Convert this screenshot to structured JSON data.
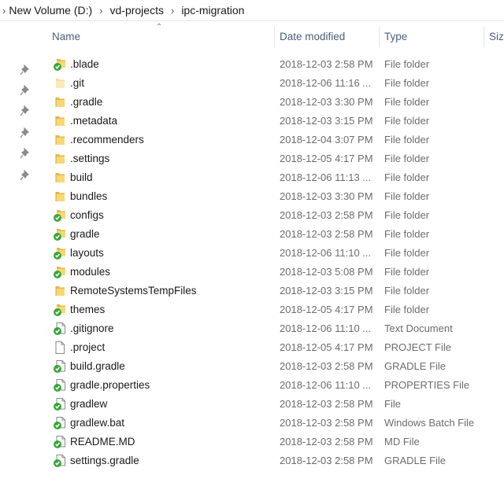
{
  "breadcrumb": [
    "New Volume (D:)",
    "vd-projects",
    "ipc-migration"
  ],
  "columns": {
    "name": "Name",
    "date": "Date modified",
    "type": "Type",
    "size": "Size"
  },
  "rows": [
    {
      "name": ".blade",
      "date": "2018-12-03 2:58 PM",
      "type": "File folder",
      "icon": "folder-sync-icon"
    },
    {
      "name": ".git",
      "date": "2018-12-06 11:16 ...",
      "type": "File folder",
      "icon": "folder-hidden-icon"
    },
    {
      "name": ".gradle",
      "date": "2018-12-03 3:30 PM",
      "type": "File folder",
      "icon": "folder-icon"
    },
    {
      "name": ".metadata",
      "date": "2018-12-03 3:15 PM",
      "type": "File folder",
      "icon": "folder-icon"
    },
    {
      "name": ".recommenders",
      "date": "2018-12-04 3:07 PM",
      "type": "File folder",
      "icon": "folder-icon"
    },
    {
      "name": ".settings",
      "date": "2018-12-05 4:17 PM",
      "type": "File folder",
      "icon": "folder-icon"
    },
    {
      "name": "build",
      "date": "2018-12-06 11:13 ...",
      "type": "File folder",
      "icon": "folder-icon"
    },
    {
      "name": "bundles",
      "date": "2018-12-03 3:30 PM",
      "type": "File folder",
      "icon": "folder-icon"
    },
    {
      "name": "configs",
      "date": "2018-12-03 2:58 PM",
      "type": "File folder",
      "icon": "folder-sync-icon"
    },
    {
      "name": "gradle",
      "date": "2018-12-03 2:58 PM",
      "type": "File folder",
      "icon": "folder-sync-icon"
    },
    {
      "name": "layouts",
      "date": "2018-12-06 11:10 ...",
      "type": "File folder",
      "icon": "folder-sync-icon"
    },
    {
      "name": "modules",
      "date": "2018-12-03 5:08 PM",
      "type": "File folder",
      "icon": "folder-sync-icon"
    },
    {
      "name": "RemoteSystemsTempFiles",
      "date": "2018-12-03 3:15 PM",
      "type": "File folder",
      "icon": "folder-icon"
    },
    {
      "name": "themes",
      "date": "2018-12-05 4:17 PM",
      "type": "File folder",
      "icon": "folder-sync-icon"
    },
    {
      "name": ".gitignore",
      "date": "2018-12-06 11:10 ...",
      "type": "Text Document",
      "icon": "file-sync-icon"
    },
    {
      "name": ".project",
      "date": "2018-12-05 4:17 PM",
      "type": "PROJECT File",
      "icon": "file-icon"
    },
    {
      "name": "build.gradle",
      "date": "2018-12-03 2:58 PM",
      "type": "GRADLE File",
      "icon": "file-sync-icon"
    },
    {
      "name": "gradle.properties",
      "date": "2018-12-06 11:10 ...",
      "type": "PROPERTIES File",
      "icon": "file-sync-icon"
    },
    {
      "name": "gradlew",
      "date": "2018-12-03 2:58 PM",
      "type": "File",
      "icon": "file-sync-icon"
    },
    {
      "name": "gradlew.bat",
      "date": "2018-12-03 2:58 PM",
      "type": "Windows Batch File",
      "icon": "file-sync-icon"
    },
    {
      "name": "README.MD",
      "date": "2018-12-03 2:58 PM",
      "type": "MD File",
      "icon": "file-sync-icon"
    },
    {
      "name": "settings.gradle",
      "date": "2018-12-03 2:58 PM",
      "type": "GRADLE File",
      "icon": "file-sync-icon"
    }
  ],
  "colors": {
    "header_text": "#4c607a",
    "folder": "#f8d775",
    "sync_green": "#3aa53a",
    "secondary_text": "#6d6d6d"
  }
}
